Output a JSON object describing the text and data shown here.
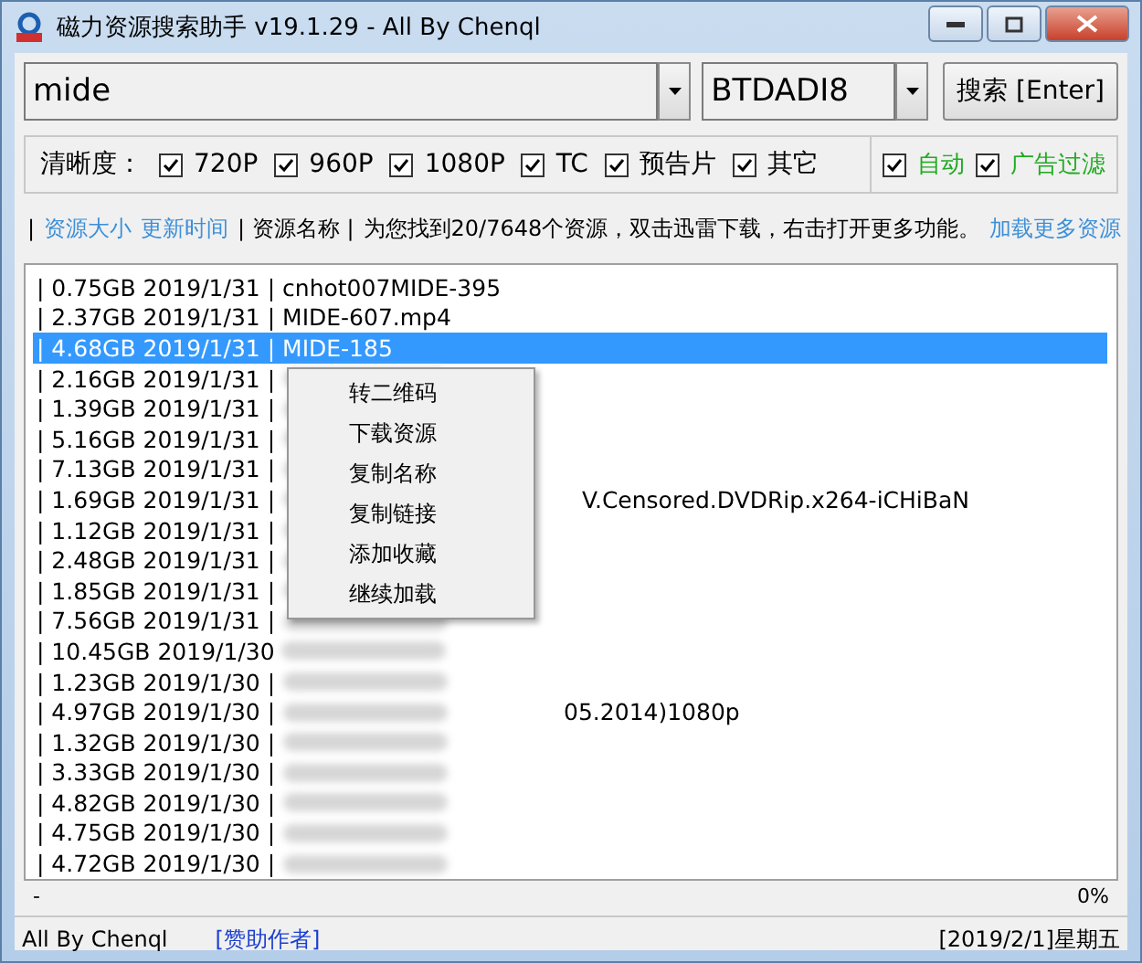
{
  "window": {
    "title": "磁力资源搜索助手 v19.1.29 - All By Chenql"
  },
  "search": {
    "query": "mide",
    "source": "BTDADI8",
    "button": "搜索 [Enter]"
  },
  "filters": {
    "label": "清晰度：",
    "options": [
      {
        "label": "720P",
        "checked": true
      },
      {
        "label": "960P",
        "checked": true
      },
      {
        "label": "1080P",
        "checked": true
      },
      {
        "label": "TC",
        "checked": true
      },
      {
        "label": "预告片",
        "checked": true
      },
      {
        "label": "其它",
        "checked": true
      }
    ],
    "extras": [
      {
        "label": "自动",
        "checked": true
      },
      {
        "label": "广告过滤",
        "checked": true
      }
    ]
  },
  "info_bar": {
    "divider": "|",
    "sort_links": [
      "资源大小",
      "更新时间"
    ],
    "column_label": "| 资源名称 |",
    "message": "为您找到20/7648个资源，双击迅雷下载，右击打开更多功能。",
    "load_more": "加载更多资源"
  },
  "results": [
    {
      "kind": "plain",
      "info": "| 0.75GB 2019/1/31 |",
      "name": "cnhot007MIDE-395",
      "selected": false
    },
    {
      "kind": "plain",
      "info": "| 2.37GB 2019/1/31 |",
      "name": "MIDE-607.mp4",
      "selected": false
    },
    {
      "kind": "plain",
      "info": "| 4.68GB 2019/1/31 |",
      "name": "MIDE-185",
      "selected": true
    },
    {
      "kind": "blurred",
      "info": "| 2.16GB 2019/1/31 |",
      "selected": false
    },
    {
      "kind": "blurred",
      "info": "| 1.39GB 2019/1/31 |",
      "selected": false
    },
    {
      "kind": "blurred",
      "info": "| 5.16GB 2019/1/31 |",
      "selected": false
    },
    {
      "kind": "blurred",
      "info": "| 7.13GB 2019/1/31 |",
      "selected": false
    },
    {
      "kind": "blurred",
      "info": "| 1.69GB 2019/1/31 |",
      "name": "V.Censored.DVDRip.x264-iCHiBaN",
      "selected": false
    },
    {
      "kind": "blurred",
      "info": "| 1.12GB 2019/1/31 |",
      "selected": false
    },
    {
      "kind": "blurred",
      "info": "| 2.48GB 2019/1/31 |",
      "selected": false
    },
    {
      "kind": "blurred",
      "info": "| 1.85GB 2019/1/31 |",
      "selected": false
    },
    {
      "kind": "blurred",
      "info": "| 7.56GB 2019/1/31 |",
      "selected": false
    },
    {
      "kind": "blurred",
      "info": "| 10.45GB 2019/1/30",
      "selected": false
    },
    {
      "kind": "blurred",
      "info": "| 1.23GB 2019/1/30 |",
      "selected": false
    },
    {
      "kind": "blurred",
      "info": "| 4.97GB 2019/1/30 |",
      "name": "05.2014)1080p",
      "selected": false
    },
    {
      "kind": "blurred",
      "info": "| 1.32GB 2019/1/30 |",
      "selected": false
    },
    {
      "kind": "blurred",
      "info": "| 3.33GB 2019/1/30 |",
      "selected": false
    },
    {
      "kind": "blurred",
      "info": "| 4.82GB 2019/1/30 |",
      "selected": false
    },
    {
      "kind": "blurred",
      "info": "| 4.75GB 2019/1/30 |",
      "selected": false
    },
    {
      "kind": "blurred",
      "info": "| 4.72GB 2019/1/30 |",
      "selected": false
    }
  ],
  "context_menu": {
    "items": [
      "转二维码",
      "下载资源",
      "复制名称",
      "复制链接",
      "添加收藏",
      "继续加载"
    ]
  },
  "progress": {
    "dash": "-",
    "percent": "0%"
  },
  "status_bar": {
    "author": "All By Chenql",
    "sponsor": "[赞助作者]",
    "date": "[2019/2/1]星期五"
  }
}
